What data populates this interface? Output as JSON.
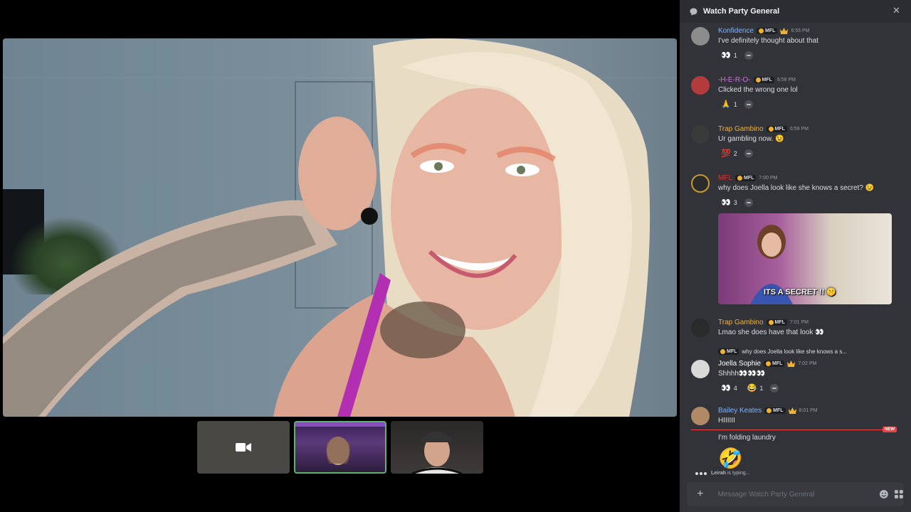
{
  "panel": {
    "title": "Watch Party General",
    "composer_placeholder": "Message Watch Party General",
    "typing_user": "Leirah",
    "typing_suffix": "is typing...",
    "new_label": "NEW"
  },
  "badge_label": "MFL",
  "messages": [
    {
      "user": "Konfidence",
      "color": "#80b3ff",
      "time": "6:55 PM",
      "text": "I've definitely thought about that",
      "reactions": [
        {
          "emoji": "👀",
          "count": "1"
        }
      ]
    },
    {
      "user": "-H-E-R-O-",
      "color": "#c678dd",
      "time": "6:58 PM",
      "text": "Clicked the wrong one lol",
      "reactions": [
        {
          "emoji": "🙏",
          "count": "1"
        }
      ]
    },
    {
      "user": "Trap Gambino",
      "color": "#f0b232",
      "time": "6:59 PM",
      "text": "Ur gambling now. 😉",
      "reactions": [
        {
          "emoji": "💯",
          "count": "2"
        }
      ]
    },
    {
      "user": "MFL",
      "color": "#e03131",
      "time": "7:00 PM",
      "text": "why does Joella look like she knows a secret? 😉",
      "reactions": [
        {
          "emoji": "👀",
          "count": "3"
        }
      ],
      "gif_caption": "ITS A SECRET !! 🤫"
    },
    {
      "user": "Trap Gambino",
      "color": "#f0b232",
      "time": "7:01 PM",
      "text": "Lmao she does have that look 👀",
      "reactions": []
    },
    {
      "user": "Joella Sophie",
      "color": "#ffffff",
      "time": "7:02 PM",
      "text": "Shhhh👀👀👀",
      "reply": "why does Joella look like she knows a s...",
      "reactions": [
        {
          "emoji": "👀",
          "count": "4"
        },
        {
          "emoji": "😂",
          "count": "1"
        }
      ]
    },
    {
      "user": "Bailey Keates",
      "color": "#80b3ff",
      "time": "8:01 PM",
      "text": "HIIIIII",
      "reactions": []
    }
  ],
  "followups": {
    "laundry": "I'm folding laundry",
    "emoji": "🤣"
  }
}
